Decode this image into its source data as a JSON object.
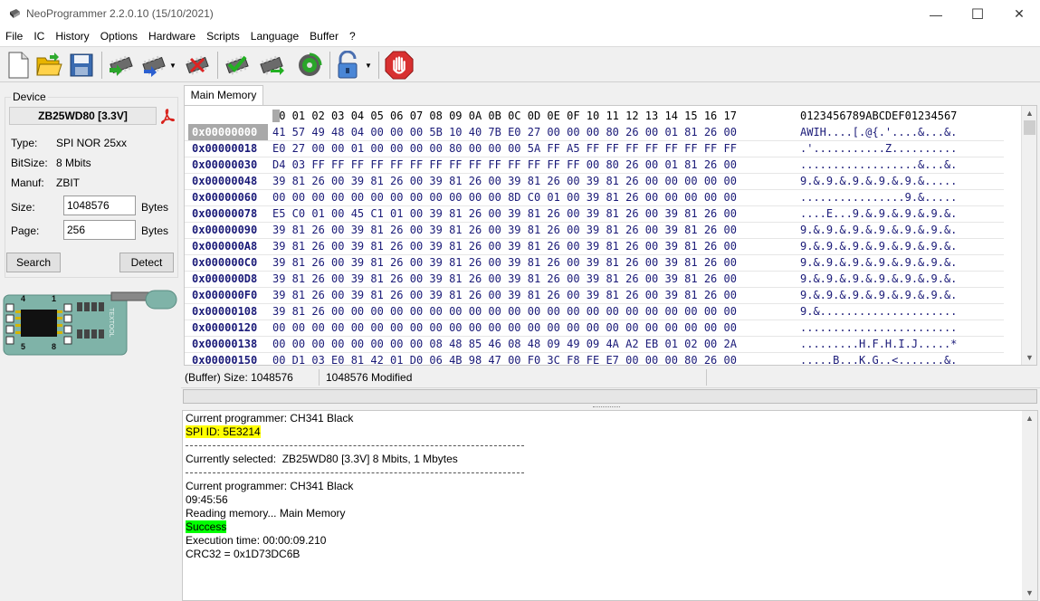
{
  "window": {
    "title": "NeoProgrammer 2.2.0.10 (15/10/2021)",
    "minimize": "—",
    "maximize": "☐",
    "close": "✕"
  },
  "menu": [
    "File",
    "IC",
    "History",
    "Options",
    "Hardware",
    "Scripts",
    "Language",
    "Buffer",
    "?"
  ],
  "toolbar": {
    "icons": [
      "new-file-icon",
      "open-folder-icon",
      "save-icon",
      "read-chip-icon",
      "write-chip-icon",
      "dropdown-arrow",
      "erase-chip-icon",
      "verify-chip-icon",
      "blank-check-icon",
      "auto-icon",
      "lock-icon",
      "dropdown-arrow",
      "stop-icon"
    ]
  },
  "device": {
    "group_title": "Device",
    "name": "ZB25WD80 [3.3V]",
    "type_label": "Type:",
    "type_value": "SPI NOR  25xx",
    "bitsize_label": "BitSize:",
    "bitsize_value": "8 Mbits",
    "manuf_label": "Manuf:",
    "manuf_value": "ZBIT",
    "size_label": "Size:",
    "size_value": "1048576",
    "size_unit": "Bytes",
    "page_label": "Page:",
    "page_value": "256",
    "page_unit": "Bytes",
    "search_label": "Search",
    "detect_label": "Detect",
    "socket_pins_top": [
      "4",
      "1"
    ],
    "socket_pins_bottom": [
      "5",
      "8"
    ],
    "socket_brand": "TEXTOOL"
  },
  "tab": {
    "label": "Main Memory"
  },
  "hex": {
    "header_bytes": "00 01 02 03 04 05 06 07 08 09 0A 0B 0C 0D 0E 0F 10 11 12 13 14 15 16 17",
    "header_ascii": "0123456789ABCDEF01234567",
    "rows": [
      {
        "addr": "0x00000000",
        "bytes": "41 57 49 48 04 00 00 00 5B 10 40 7B E0 27 00 00 00 80 26 00 01 81 26 00",
        "ascii": "AWIH....[.@{.'....&...&."
      },
      {
        "addr": "0x00000018",
        "bytes": "E0 27 00 00 01 00 00 00 00 80 00 00 00 5A FF A5 FF FF FF FF FF FF FF FF",
        "ascii": ".'...........Z.........."
      },
      {
        "addr": "0x00000030",
        "bytes": "D4 03 FF FF FF FF FF FF FF FF FF FF FF FF FF FF 00 80 26 00 01 81 26 00",
        "ascii": "..................&...&."
      },
      {
        "addr": "0x00000048",
        "bytes": "39 81 26 00 39 81 26 00 39 81 26 00 39 81 26 00 39 81 26 00 00 00 00 00",
        "ascii": "9.&.9.&.9.&.9.&.9.&....."
      },
      {
        "addr": "0x00000060",
        "bytes": "00 00 00 00 00 00 00 00 00 00 00 00 8D C0 01 00 39 81 26 00 00 00 00 00",
        "ascii": "................9.&....."
      },
      {
        "addr": "0x00000078",
        "bytes": "E5 C0 01 00 45 C1 01 00 39 81 26 00 39 81 26 00 39 81 26 00 39 81 26 00",
        "ascii": "....E...9.&.9.&.9.&.9.&."
      },
      {
        "addr": "0x00000090",
        "bytes": "39 81 26 00 39 81 26 00 39 81 26 00 39 81 26 00 39 81 26 00 39 81 26 00",
        "ascii": "9.&.9.&.9.&.9.&.9.&.9.&."
      },
      {
        "addr": "0x000000A8",
        "bytes": "39 81 26 00 39 81 26 00 39 81 26 00 39 81 26 00 39 81 26 00 39 81 26 00",
        "ascii": "9.&.9.&.9.&.9.&.9.&.9.&."
      },
      {
        "addr": "0x000000C0",
        "bytes": "39 81 26 00 39 81 26 00 39 81 26 00 39 81 26 00 39 81 26 00 39 81 26 00",
        "ascii": "9.&.9.&.9.&.9.&.9.&.9.&."
      },
      {
        "addr": "0x000000D8",
        "bytes": "39 81 26 00 39 81 26 00 39 81 26 00 39 81 26 00 39 81 26 00 39 81 26 00",
        "ascii": "9.&.9.&.9.&.9.&.9.&.9.&."
      },
      {
        "addr": "0x000000F0",
        "bytes": "39 81 26 00 39 81 26 00 39 81 26 00 39 81 26 00 39 81 26 00 39 81 26 00",
        "ascii": "9.&.9.&.9.&.9.&.9.&.9.&."
      },
      {
        "addr": "0x00000108",
        "bytes": "39 81 26 00 00 00 00 00 00 00 00 00 00 00 00 00 00 00 00 00 00 00 00 00",
        "ascii": "9.&....................."
      },
      {
        "addr": "0x00000120",
        "bytes": "00 00 00 00 00 00 00 00 00 00 00 00 00 00 00 00 00 00 00 00 00 00 00 00",
        "ascii": "........................"
      },
      {
        "addr": "0x00000138",
        "bytes": "00 00 00 00 00 00 00 00 08 48 85 46 08 48 09 49 09 4A A2 EB 01 02 00 2A",
        "ascii": ".........H.F.H.I.J.....*"
      },
      {
        "addr": "0x00000150",
        "bytes": "00 D1 03 E0 81 42 01 D0 06 4B 98 47 00 F0 3C F8 FE E7 00 00 00 80 26 00",
        "ascii": ".....B...K.G..<.......&."
      }
    ]
  },
  "status": {
    "buffer_size": "(Buffer) Size: 1048576",
    "modified": "1048576 Modified"
  },
  "log": {
    "lines": [
      {
        "text": "Current programmer: CH341 Black",
        "style": ""
      },
      {
        "text": "SPI ID: 5E3214",
        "style": "yellow"
      },
      {
        "text": "---",
        "style": "dash"
      },
      {
        "text": "Currently selected:  ZB25WD80 [3.3V] 8 Mbits, 1 Mbytes",
        "style": ""
      },
      {
        "text": "---",
        "style": "dash"
      },
      {
        "text": "Current programmer: CH341 Black",
        "style": ""
      },
      {
        "text": "09:45:56",
        "style": ""
      },
      {
        "text": "Reading memory... Main Memory",
        "style": ""
      },
      {
        "text": "Success",
        "style": "green"
      },
      {
        "text": "Execution time: 00:00:09.210",
        "style": ""
      },
      {
        "text": "CRC32 = 0x1D73DC6B",
        "style": ""
      }
    ]
  }
}
